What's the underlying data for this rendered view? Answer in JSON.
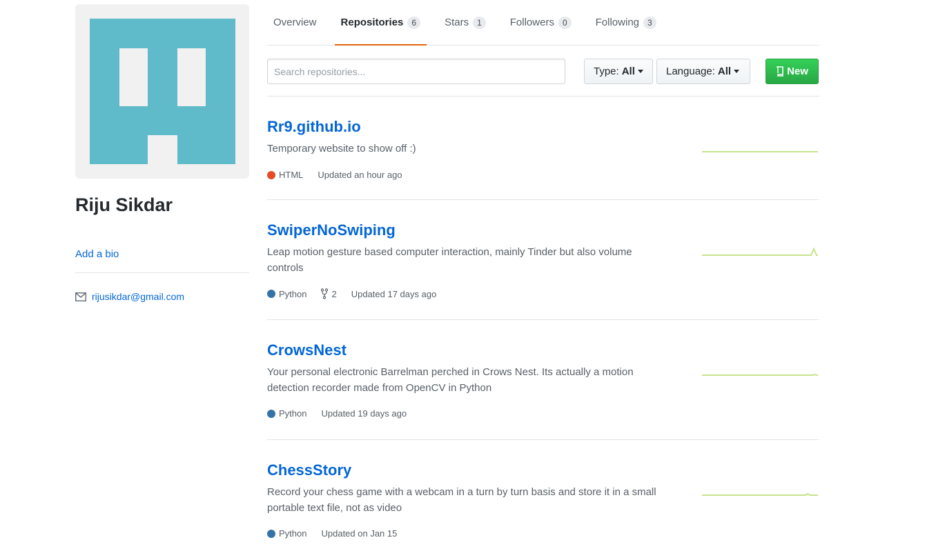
{
  "profile": {
    "name": "Riju Sikdar",
    "bio_link": "Add a bio",
    "email": "rijusikdar@gmail.com",
    "avatar_color": "#5fbbc9"
  },
  "tabs": [
    {
      "label": "Overview",
      "count": null
    },
    {
      "label": "Repositories",
      "count": "6"
    },
    {
      "label": "Stars",
      "count": "1"
    },
    {
      "label": "Followers",
      "count": "0"
    },
    {
      "label": "Following",
      "count": "3"
    }
  ],
  "filters": {
    "search_placeholder": "Search repositories...",
    "type_label": "Type:",
    "type_value": "All",
    "language_label": "Language:",
    "language_value": "All",
    "new_label": "New"
  },
  "repos": [
    {
      "name": "Rr9.github.io",
      "description": "Temporary website to show off :)",
      "language": "HTML",
      "language_color": "#e34c26",
      "forks": null,
      "updated": "Updated an hour ago"
    },
    {
      "name": "SwiperNoSwiping",
      "description": "Leap motion gesture based computer interaction, mainly Tinder but also volume controls",
      "language": "Python",
      "language_color": "#3572a5",
      "forks": "2",
      "updated": "Updated 17 days ago"
    },
    {
      "name": "CrowsNest",
      "description": "Your personal electronic Barrelman perched in Crows Nest. Its actually a motion detection recorder made from OpenCV in Python",
      "language": "Python",
      "language_color": "#3572a5",
      "forks": null,
      "updated": "Updated 19 days ago"
    },
    {
      "name": "ChessStory",
      "description": "Record your chess game with a webcam in a turn by turn basis and store it in a small portable text file, not as video",
      "language": "Python",
      "language_color": "#3572a5",
      "forks": null,
      "updated": "Updated on Jan 15"
    }
  ],
  "colors": {
    "link": "#0366d6",
    "active_tab_underline": "#e36209",
    "sparkline": "#c6e48b",
    "new_button": "#28a745"
  }
}
